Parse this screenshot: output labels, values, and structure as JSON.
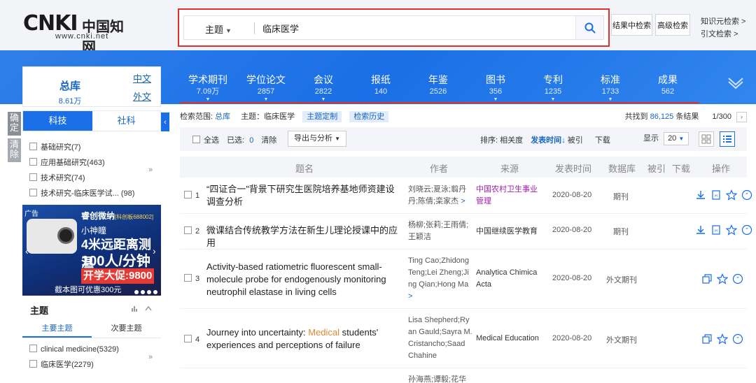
{
  "logo": {
    "mark": "CNKI",
    "cn": "中国知网",
    "url": "www.cnki.net"
  },
  "search": {
    "field": "主题",
    "query": "临床医学",
    "search_in_results": "结果中检索",
    "advanced": "高级检索",
    "links": [
      "知识元检索 >",
      "引文检索 >"
    ]
  },
  "nav": [
    {
      "name": "学术期刊",
      "count": "7.09万"
    },
    {
      "name": "学位论文",
      "count": "2857"
    },
    {
      "name": "会议",
      "count": "2822"
    },
    {
      "name": "报纸",
      "count": "140"
    },
    {
      "name": "年鉴",
      "count": "2526"
    },
    {
      "name": "图书",
      "count": "356"
    },
    {
      "name": "专利",
      "count": "1235"
    },
    {
      "name": "标准",
      "count": "1733"
    },
    {
      "name": "成果",
      "count": "562"
    }
  ],
  "library": {
    "title": "总库",
    "count": "8.61万",
    "zh": "中文",
    "en": "外文"
  },
  "cat_tabs": {
    "sci": "科技",
    "soc": "社科"
  },
  "side_buttons": {
    "confirm": "确定",
    "clear": "清除"
  },
  "subjects": [
    "基础研究(7)",
    "应用基础研究(463)",
    "技术研究(74)",
    "技术研究-临床医学试...  (98)"
  ],
  "ad": {
    "tag": "广告",
    "brand": "睿创微纳",
    "model": "[科创板688002]",
    "l1": "小神瞳",
    "l2": "4米远距离测温",
    "l3": "100人/分钟",
    "l4": "开学大促:9800",
    "l5": "截本图可优惠300元"
  },
  "topic": {
    "title": "主题",
    "tab_main": "主要主题",
    "tab_sub": "次要主题",
    "items": [
      "clinical medicine(5329)",
      "临床医学(2279)"
    ]
  },
  "crumb": {
    "scope_label": "检索范围:",
    "scope": "总库",
    "subject": "主题：临床医学",
    "custom": "主题定制",
    "history": "检索历史",
    "found_prefix": "共找到",
    "found": "86,125",
    "found_suffix": "条结果",
    "page": "1/300"
  },
  "toolbar": {
    "select_all": "全选",
    "selected_label": "已选:",
    "selected": "0",
    "clear": "清除",
    "export": "导出与分析",
    "sort_label": "排序:",
    "sort_rel": "相关度",
    "sort_time": "发表时间",
    "sort_cite": "被引",
    "sort_dl": "下载",
    "show": "显示",
    "page_size": "20"
  },
  "columns": {
    "title": "题名",
    "author": "作者",
    "source": "来源",
    "date": "发表时间",
    "db": "数据库",
    "cite": "被引",
    "download": "下载",
    "ops": "操作"
  },
  "rows": [
    {
      "idx": "1",
      "title": "“四证合一”背景下研究生医院培养基地师资建设调查分析",
      "title_hl": "",
      "title_post": "",
      "author": "刘晓云;夏泳;翦丹丹;陈倩;栾家杰",
      "author_more": ">",
      "source": "中国农村卫生事业管理",
      "source_color": "#a21caf",
      "date": "2020-08-20",
      "db": "期刊"
    },
    {
      "idx": "2",
      "title": "微课结合传统教学方法在新生儿理论授课中的应用",
      "title_hl": "",
      "title_post": "",
      "author": "杨柳;张莉;王雨倩;王颖洁",
      "author_more": "",
      "source": "中国继续医学教育",
      "source_color": "#333333",
      "date": "2020-08-20",
      "db": "期刊"
    },
    {
      "idx": "3",
      "title": "Activity-based ratiometric fluorescent small-molecule probe for endogenously monitoring neutrophil elastase in living cells",
      "title_hl": "",
      "title_post": "",
      "author": "Ting Cao;Zhidong Teng;Lei Zheng;Jing Qian;Hong Ma",
      "author_more": ">",
      "source": "Analytica Chimica Acta",
      "source_color": "#333333",
      "date": "2020-08-20",
      "db": "外文期刊"
    },
    {
      "idx": "4",
      "title": "Journey into uncertainty: ",
      "title_hl": "Medical",
      "title_post": " students' experiences and perceptions of failure",
      "author": "Lisa Shepherd;Ryan Gauld;Sayra M. Cristancho;Saad Chahine",
      "author_more": "",
      "source": "Medical Education",
      "source_color": "#333333",
      "date": "2020-08-20",
      "db": "外文期刊"
    },
    {
      "idx": "5",
      "title": "",
      "title_hl": "",
      "title_post": "",
      "author": "孙海燕;谭毅;花华",
      "author_more": "",
      "source": "",
      "source_color": "#333333",
      "date": "",
      "db": ""
    }
  ],
  "colors": {
    "brand_blue": "#1a6fe6",
    "highlight_red": "#e0312f"
  }
}
